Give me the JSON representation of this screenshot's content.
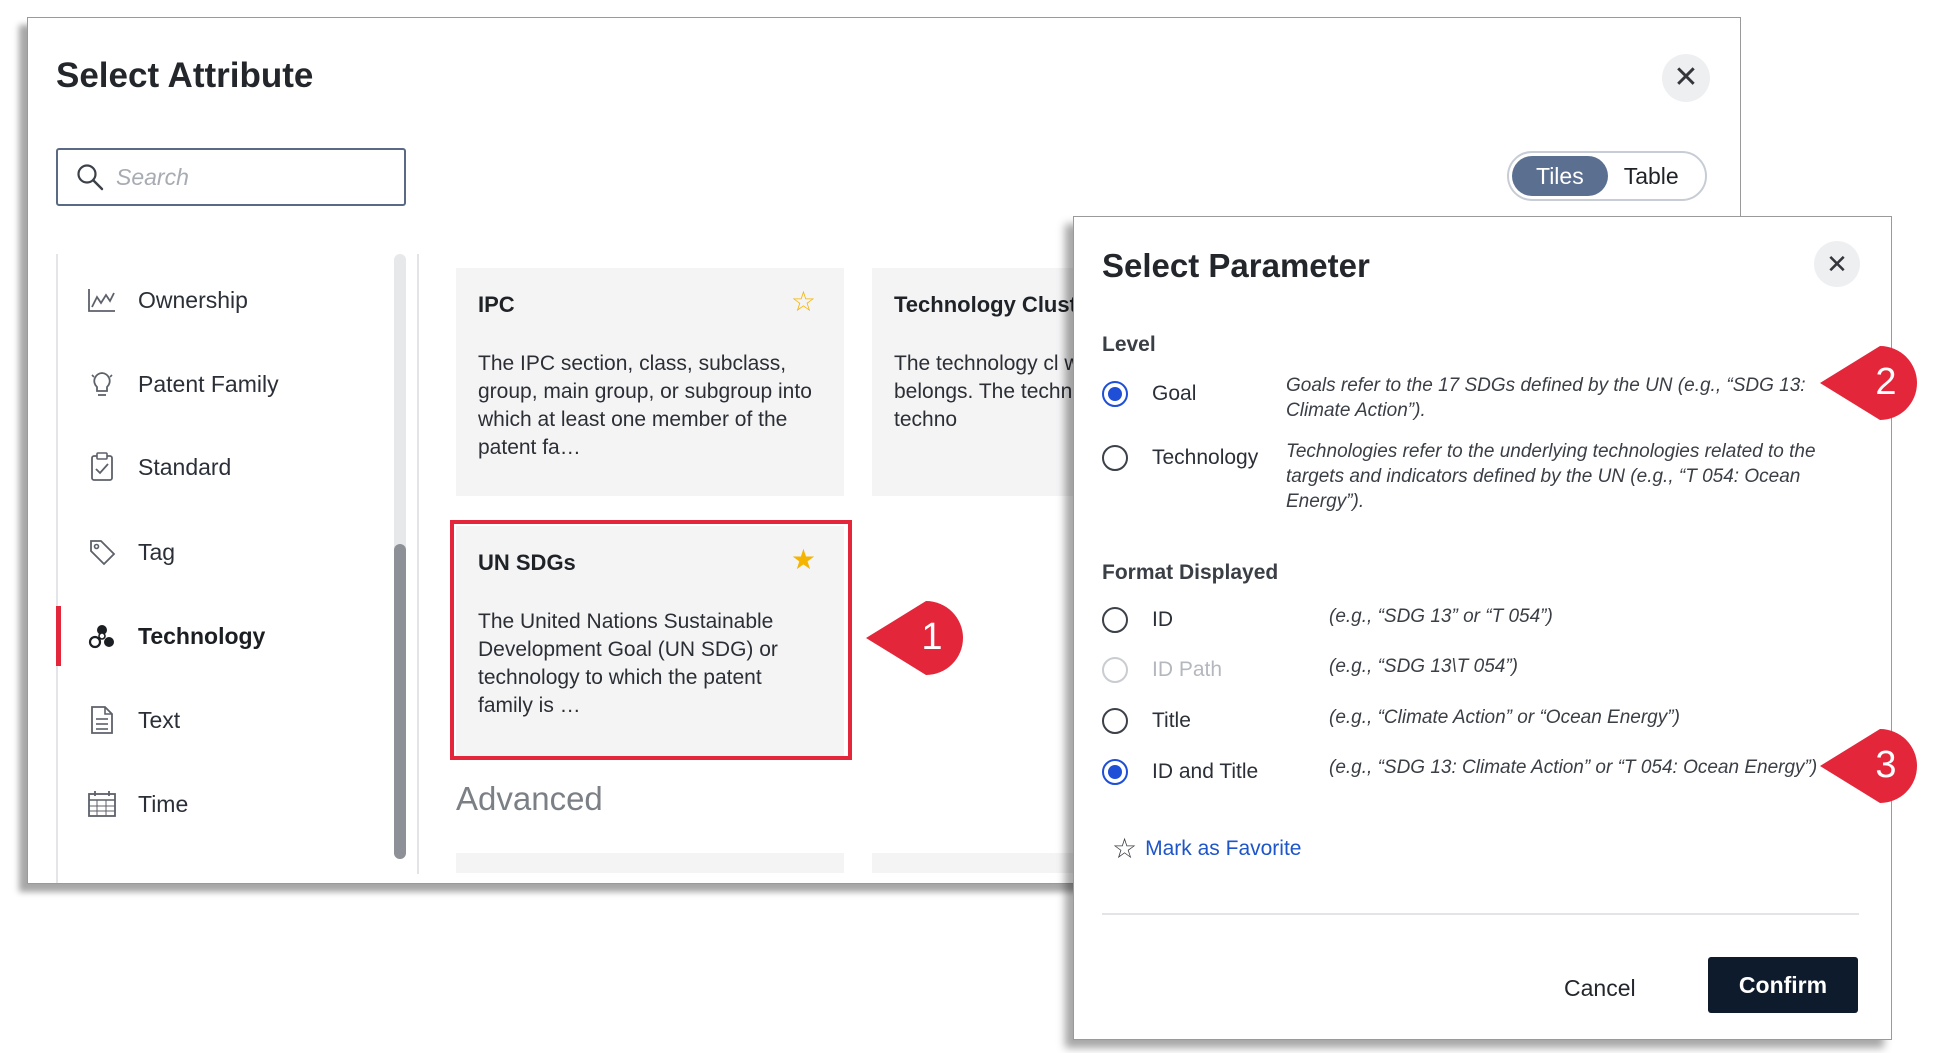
{
  "select_attribute": {
    "title": "Select Attribute",
    "search_placeholder": "Search",
    "view_options": [
      "Tiles",
      "Table"
    ],
    "active_view": "Tiles",
    "sidebar": [
      {
        "label": "Ownership",
        "icon": "line-chart-icon"
      },
      {
        "label": "Patent Family",
        "icon": "lightbulb-icon"
      },
      {
        "label": "Standard",
        "icon": "clipboard-icon"
      },
      {
        "label": "Tag",
        "icon": "tag-icon"
      },
      {
        "label": "Technology",
        "icon": "atom-icon",
        "active": true
      },
      {
        "label": "Text",
        "icon": "document-icon"
      },
      {
        "label": "Time",
        "icon": "calendar-icon"
      }
    ],
    "tiles": [
      {
        "name": "IPC",
        "description": "The IPC section, class, subclass, group, main group, or subgroup into which at least one member of the patent fa…",
        "favorite": false
      },
      {
        "name": "Technology Cluste",
        "description": "The technology cl which the patent f belongs. The techn clusters are techno"
      },
      {
        "name": "UN SDGs",
        "description": "The United Nations Sustainable Development Goal (UN SDG) or technology to which the patent family is …",
        "favorite": true
      }
    ],
    "section_advanced": "Advanced"
  },
  "select_parameter": {
    "title": "Select Parameter",
    "level_label": "Level",
    "level_options": [
      {
        "label": "Goal",
        "checked": true,
        "description": "Goals refer to the 17 SDGs defined by the UN (e.g., “SDG 13: Climate Action”)."
      },
      {
        "label": "Technology",
        "checked": false,
        "description": "Technologies refer to the underlying technologies related to the targets and indicators defined by the UN (e.g., “T 054: Ocean Energy”)."
      }
    ],
    "format_label": "Format Displayed",
    "format_options": [
      {
        "label": "ID",
        "checked": false,
        "disabled": false,
        "description": "(e.g., “SDG 13” or “T 054”)"
      },
      {
        "label": "ID Path",
        "checked": false,
        "disabled": true,
        "description": "(e.g., “SDG 13\\T 054”)"
      },
      {
        "label": "Title",
        "checked": false,
        "disabled": false,
        "description": "(e.g., “Climate Action” or “Ocean Energy”)"
      },
      {
        "label": "ID and Title",
        "checked": true,
        "disabled": false,
        "description": "(e.g., “SDG 13: Climate Action” or “T 054: Ocean Energy”)"
      }
    ],
    "favorite_link": "Mark as Favorite",
    "cancel_label": "Cancel",
    "confirm_label": "Confirm"
  },
  "callouts": [
    "1",
    "2",
    "3"
  ],
  "colors": {
    "accent_red": "#e3263a",
    "radio_blue": "#1e4fd6",
    "confirm_bg": "#0e1b2c",
    "favorite_star": "#f5b400",
    "toggle_active": "#5b6f91"
  }
}
